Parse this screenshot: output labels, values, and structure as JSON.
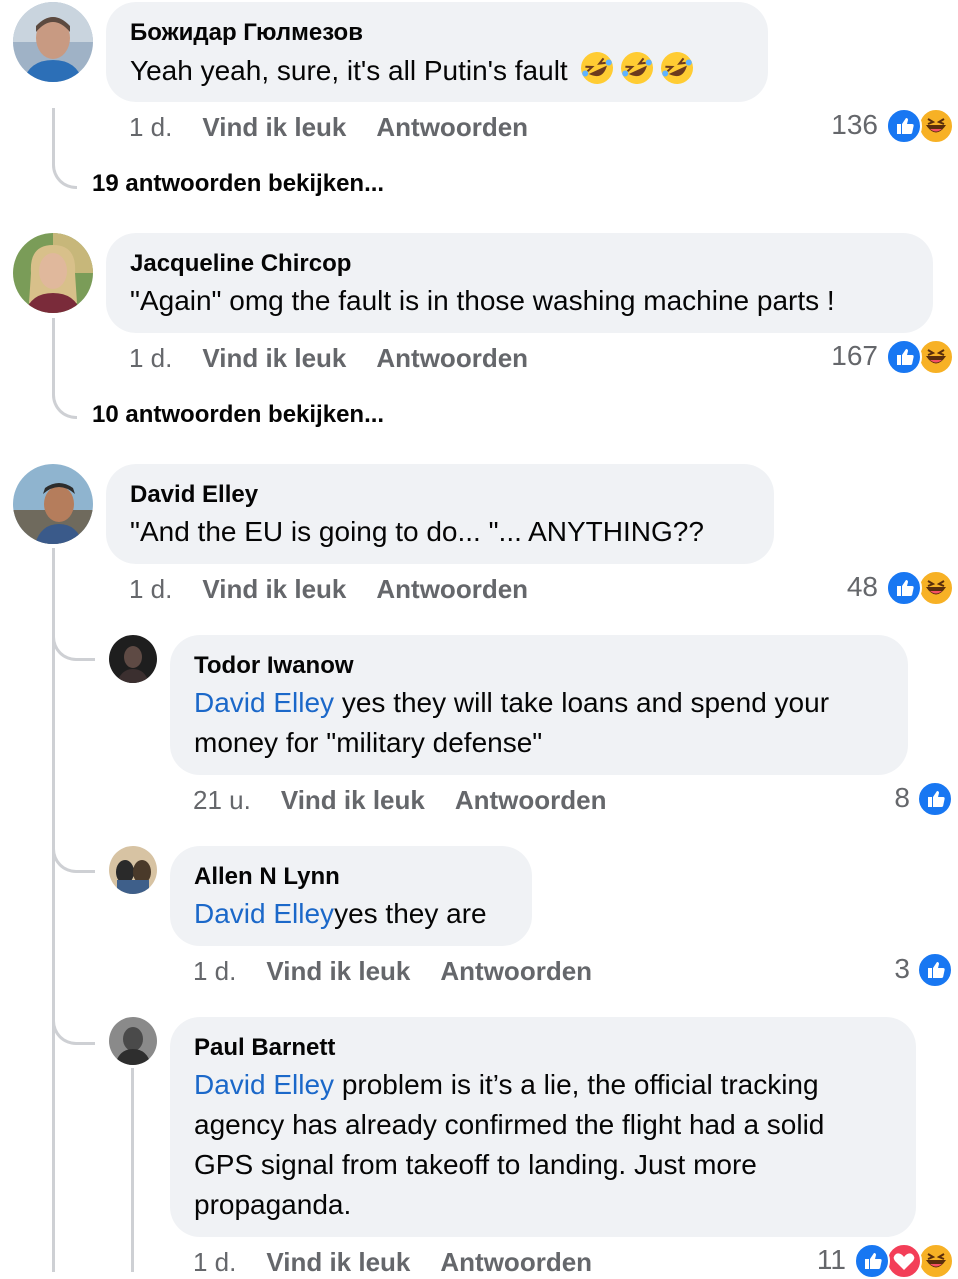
{
  "comments": [
    {
      "author": "Божидар Гюлмезов",
      "text": "Yeah yeah, sure, it's all Putin's fault",
      "text_emoji": "rolling-on-floor-laughing x3",
      "time": "1 d.",
      "like": "Vind ik leuk",
      "reply": "Antwoorden",
      "count": "136",
      "replies_link": "19 antwoorden bekijken..."
    },
    {
      "author": "Jacqueline Chircop",
      "text": "\"Again\" omg the fault is in those washing machine parts !",
      "time": "1 d.",
      "like": "Vind ik leuk",
      "reply": "Antwoorden",
      "count": "167",
      "replies_link": "10 antwoorden bekijken..."
    },
    {
      "author": "David Elley",
      "text": "\"And the EU is going to do... \"... ANYTHING??",
      "time": "1 d.",
      "like": "Vind ik leuk",
      "reply": "Antwoorden",
      "count": "48"
    }
  ],
  "replies": [
    {
      "author": "Todor Iwanow",
      "mention": "David Elley",
      "line1": " yes they will take loans and spend your",
      "line2": "money for \"military defense\"",
      "time": "21 u.",
      "like": "Vind ik leuk",
      "reply": "Antwoorden",
      "count": "8"
    },
    {
      "author": "Allen N Lynn",
      "mention": "David Elley",
      "line1": "yes they are",
      "time": "1 d.",
      "like": "Vind ik leuk",
      "reply": "Antwoorden",
      "count": "3"
    },
    {
      "author": "Paul Barnett",
      "mention": "David Elley",
      "line1": " problem is it’s a lie, the official tracking",
      "line2": "agency has already confirmed the flight had a solid",
      "line3": "GPS signal from takeoff to landing. Just more",
      "line4": "propaganda.",
      "time": "1 d.",
      "like": "Vind ik leuk",
      "reply": "Antwoorden",
      "count": "11"
    }
  ],
  "colors": {
    "bubble": "#f0f2f5",
    "mention": "#1b68c9",
    "meta": "#65676b",
    "like_reaction": "#1877f2",
    "haha_reaction": "#f7b125",
    "love_reaction": "#f33e58"
  },
  "icons": [
    "like-reaction-icon",
    "haha-reaction-icon",
    "love-reaction-icon",
    "rolling-laughing-emoji"
  ]
}
